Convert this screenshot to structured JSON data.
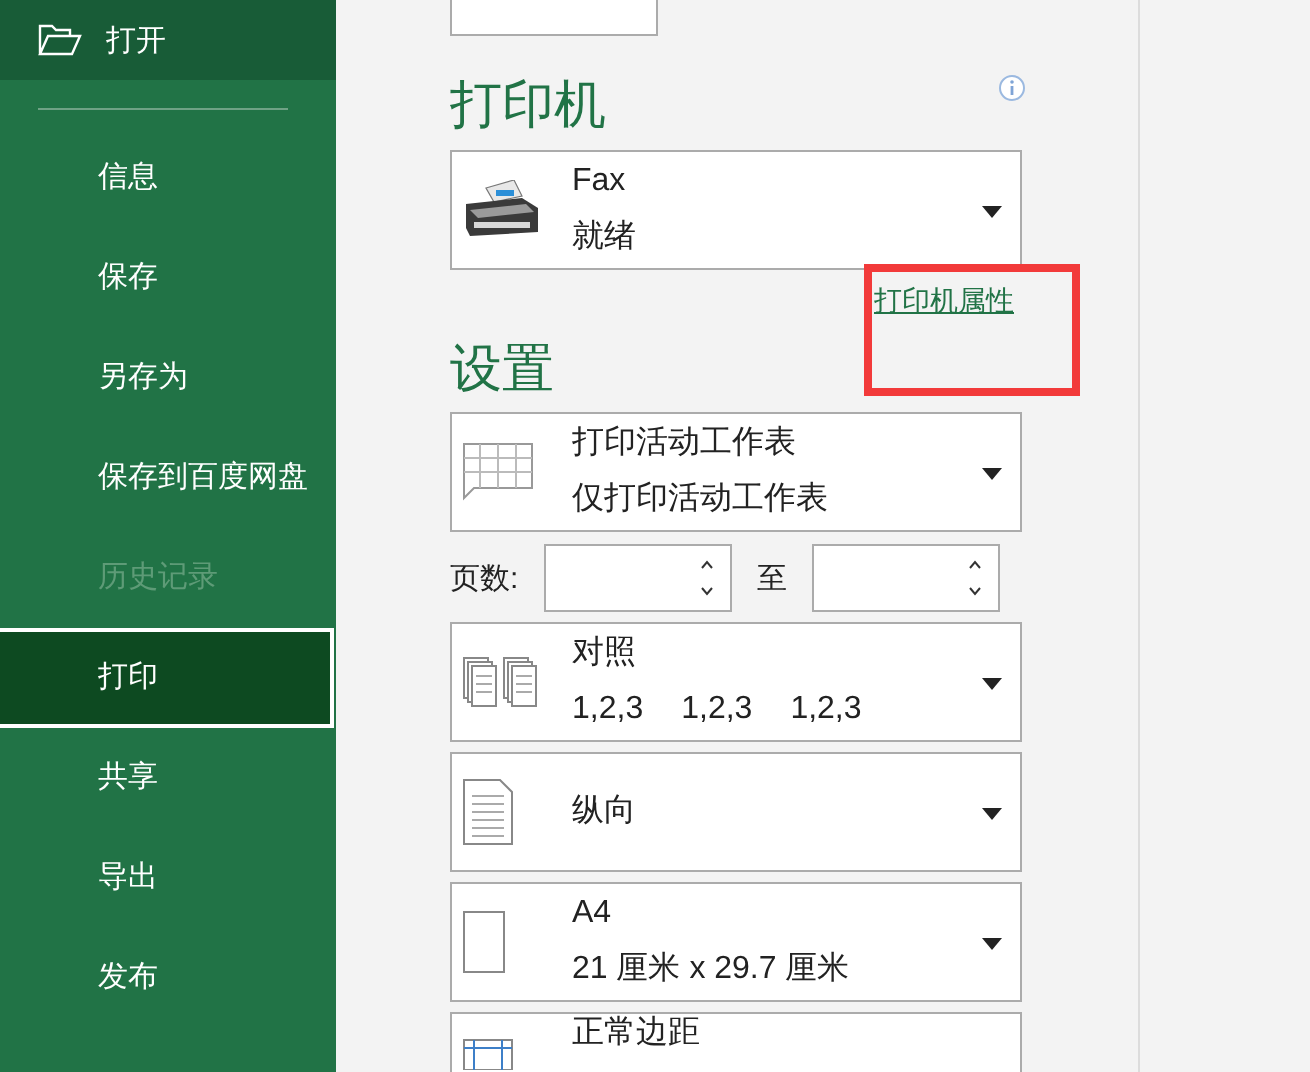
{
  "sidebar": {
    "open_item": {
      "label": "打开"
    },
    "items": [
      {
        "label": "信息",
        "selected": false,
        "disabled": false
      },
      {
        "label": "保存",
        "selected": false,
        "disabled": false
      },
      {
        "label": "另存为",
        "selected": false,
        "disabled": false
      },
      {
        "label": "保存到百度网盘",
        "selected": false,
        "disabled": false
      },
      {
        "label": "历史记录",
        "selected": false,
        "disabled": true
      },
      {
        "label": "打印",
        "selected": true,
        "disabled": false
      },
      {
        "label": "共享",
        "selected": false,
        "disabled": false
      },
      {
        "label": "导出",
        "selected": false,
        "disabled": false
      },
      {
        "label": "发布",
        "selected": false,
        "disabled": false
      }
    ]
  },
  "printer": {
    "heading": "打印机",
    "name": "Fax",
    "status": "就绪",
    "properties_link": "打印机属性"
  },
  "settings": {
    "heading": "设置",
    "dropdowns_top": [
      {
        "kind": "sheet",
        "title": "打印活动工作表",
        "subtitle": "仅打印活动工作表"
      }
    ],
    "pages": {
      "label": "页数:",
      "to_label": "至"
    },
    "dropdowns": [
      {
        "kind": "collate",
        "title": "对照",
        "sequence": [
          "1,2,3",
          "1,2,3",
          "1,2,3"
        ]
      },
      {
        "kind": "portrait",
        "title": "纵向"
      },
      {
        "kind": "paper",
        "title": "A4",
        "subtitle": "21 厘米 x 29.7 厘米"
      },
      {
        "kind": "margins",
        "title": "正常边距"
      }
    ]
  }
}
